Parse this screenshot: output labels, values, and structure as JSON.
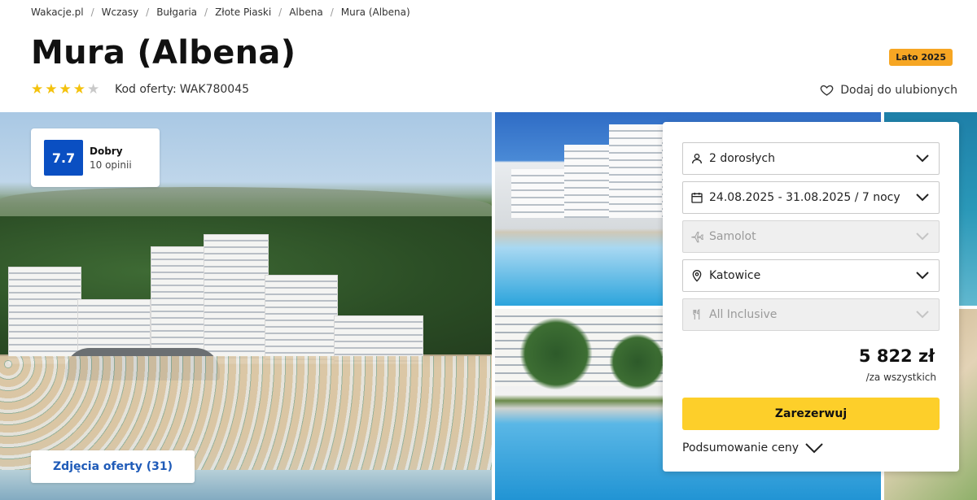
{
  "breadcrumb": [
    "Wakacje.pl",
    "Wczasy",
    "Bułgaria",
    "Złote Piaski",
    "Albena",
    "Mura (Albena)"
  ],
  "hotel": {
    "title": "Mura (Albena)",
    "stars": 4,
    "stars_max": 5,
    "offer_code_label": "Kod oferty:",
    "offer_code": "WAK780045",
    "season_badge": "Lato 2025",
    "favorite_label": "Dodaj do ulubionych"
  },
  "rating": {
    "score": "7.7",
    "label": "Dobry",
    "count": "10 opinii"
  },
  "gallery": {
    "photos_button": "Zdjęcia oferty (31)"
  },
  "booking": {
    "fields": [
      {
        "icon": "person-icon",
        "value": "2 dorosłych",
        "disabled": false
      },
      {
        "icon": "calendar-icon",
        "value": "24.08.2025 - 31.08.2025 / 7 nocy",
        "disabled": false
      },
      {
        "icon": "plane-icon",
        "value": "Samolot",
        "disabled": true
      },
      {
        "icon": "location-pin-icon",
        "value": "Katowice",
        "disabled": false
      },
      {
        "icon": "cutlery-icon",
        "value": "All Inclusive",
        "disabled": true
      }
    ],
    "price": "5 822 zł",
    "price_note": "/za wszystkich",
    "reserve_label": "Zarezerwuj",
    "summary_label": "Podsumowanie ceny"
  },
  "colors": {
    "accent_blue": "#0a4fc2",
    "reserve_yellow": "#fdcf2a",
    "badge_orange": "#f6a623",
    "star_yellow": "#f4c20d"
  }
}
